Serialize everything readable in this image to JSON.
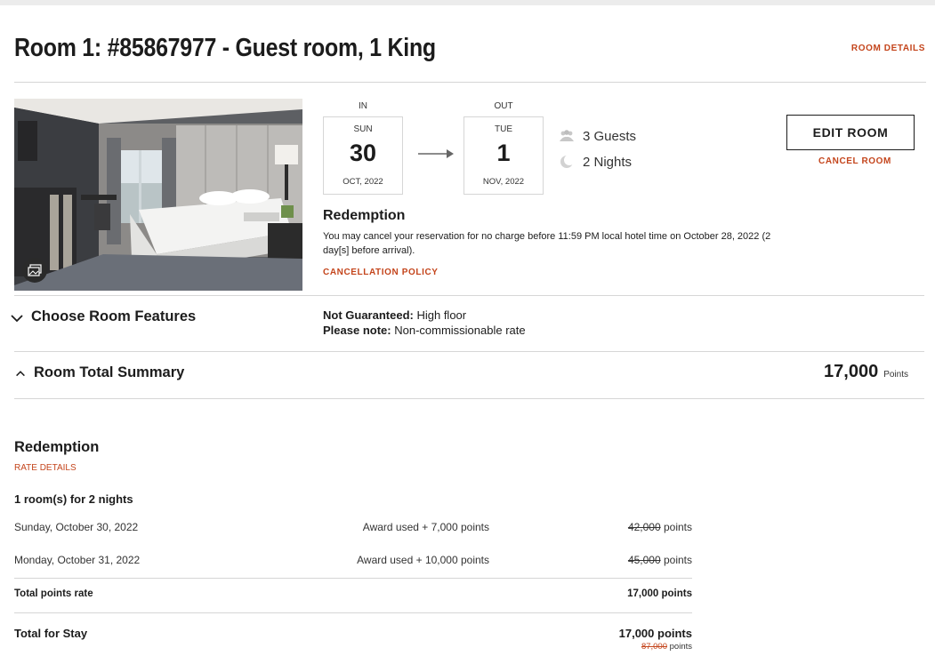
{
  "room": {
    "title": "Room 1: #85867977 - Guest room, 1 King",
    "details_link": "ROOM DETAILS"
  },
  "dates": {
    "in_label": "IN",
    "out_label": "OUT",
    "checkin": {
      "dow": "SUN",
      "day": "30",
      "month": "OCT, 2022"
    },
    "checkout": {
      "dow": "TUE",
      "day": "1",
      "month": "NOV, 2022"
    }
  },
  "stay": {
    "guests": "3 Guests",
    "nights": "2 Nights"
  },
  "actions": {
    "edit_room": "EDIT ROOM",
    "cancel_room": "CANCEL ROOM"
  },
  "redemption": {
    "heading": "Redemption",
    "text": "You may cancel your reservation for no charge before 11:59 PM local hotel time on October 28, 2022 (2 day[s] before arrival).",
    "policy_link": "CANCELLATION POLICY"
  },
  "features": {
    "label": "Choose Room Features",
    "not_guaranteed_label": "Not Guaranteed:",
    "not_guaranteed_value": "High floor",
    "please_note_label": "Please note:",
    "please_note_value": "Non-commissionable rate"
  },
  "summary": {
    "label": "Room Total Summary",
    "total": "17,000",
    "unit": "Points"
  },
  "breakdown": {
    "heading": "Redemption",
    "rate_details": "RATE DETAILS",
    "rooms_for": "1 room(s) for 2 nights",
    "nights": [
      {
        "date": "Sunday, October 30, 2022",
        "award": "Award used + 7,000 points",
        "original": "42,000",
        "unit": " points"
      },
      {
        "date": "Monday, October 31, 2022",
        "award": "Award used + 10,000 points",
        "original": "45,000",
        "unit": " points"
      }
    ],
    "total_rate_label": "Total points rate",
    "total_rate_value": "17,000 points",
    "stay_label": "Total for Stay",
    "stay_value": "17,000 points",
    "stay_original": "87,000",
    "stay_original_unit": " points"
  },
  "colors": {
    "accent": "#c4451c",
    "text": "#1c1c1c",
    "divider": "#d6d6d6"
  },
  "icons": {
    "photo_gallery": "gallery-icon",
    "guests": "people-icon",
    "nights": "moon-icon",
    "arrow": "arrow-right-icon",
    "features_toggle": "chevron-down-icon",
    "summary_toggle": "chevron-up-icon"
  }
}
